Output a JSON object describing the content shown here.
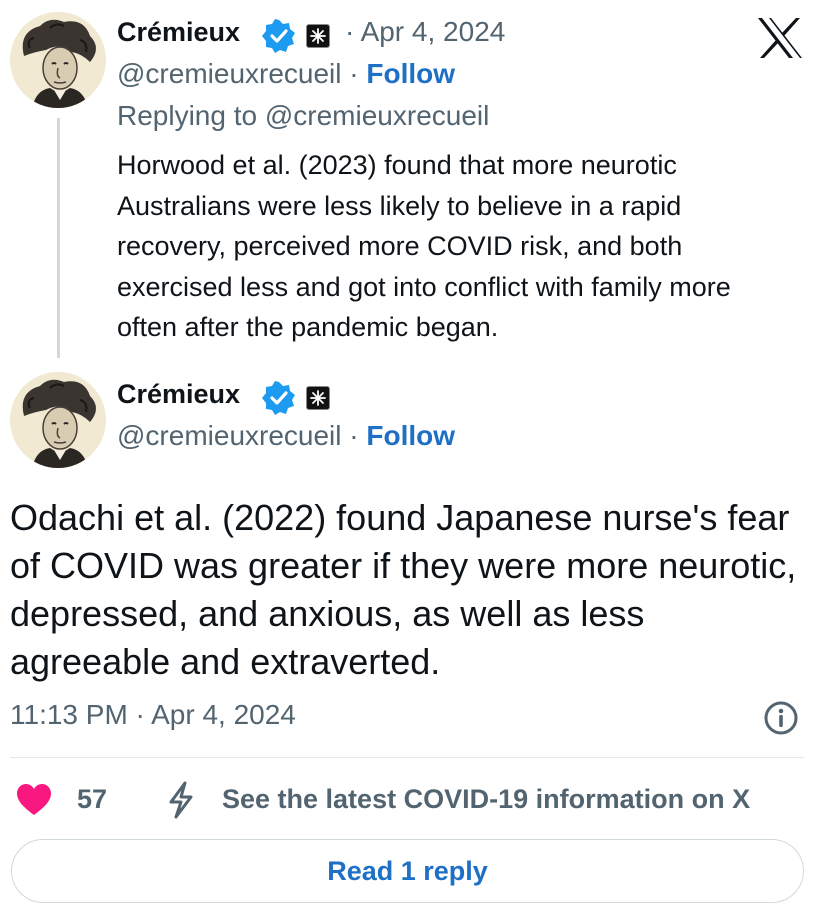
{
  "tweet1": {
    "name": "Crémieux",
    "date_sep": "·",
    "date": "Apr 4, 2024",
    "handle": "@cremieuxrecueil",
    "follow_sep": "·",
    "follow": "Follow",
    "replying": "Replying to @cremieuxrecueil",
    "text": "Horwood et al. (2023) found that more neurotic Australians were less likely to believe in a rapid recovery, perceived more COVID risk, and both exercised less and got into conflict with family more often after the pandemic began."
  },
  "tweet2": {
    "name": "Crémieux",
    "handle": "@cremieuxrecueil",
    "follow_sep": "·",
    "follow": "Follow",
    "text": "Odachi et al. (2022) found Japanese nurse's fear of COVID was greater if they were more neurotic, depressed, and anxious, as well as less agreeable and extraverted.",
    "timestamp": "11:13 PM · Apr 4, 2024"
  },
  "actions": {
    "like_count": "57",
    "covid_info": "See the latest COVID-19 information on X",
    "read_reply": "Read 1 reply"
  },
  "icons": {
    "logo": "x-logo-icon",
    "verified": "verified-badge-icon",
    "affiliate": "affiliate-badge-icon",
    "info": "info-icon",
    "like": "heart-icon",
    "covid": "lightning-icon"
  },
  "colors": {
    "verified": "#1d9bf0",
    "follow": "#1d70c6",
    "like": "#f91880",
    "secondary_text": "#536471"
  }
}
